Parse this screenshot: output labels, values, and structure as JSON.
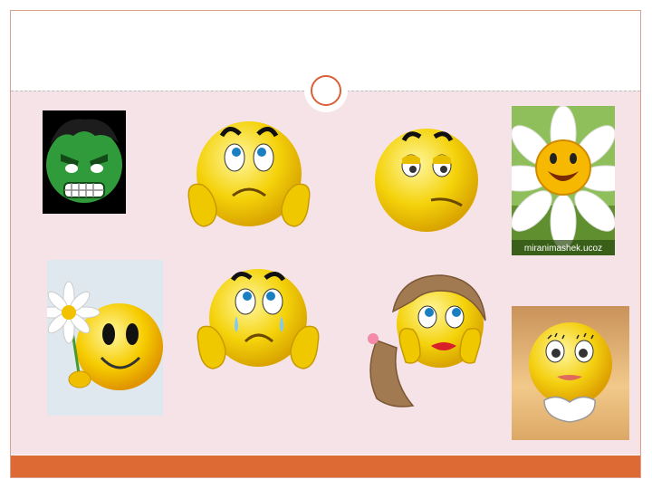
{
  "slide": {
    "accent_color": "#dd6a35",
    "content_background": "#f6e3e7",
    "frame_border_color": "#d9a08e"
  },
  "images": [
    {
      "name": "angry-green-face-icon"
    },
    {
      "name": "sad-face-hands-on-cheeks-icon"
    },
    {
      "name": "bored-smirk-face-icon"
    },
    {
      "name": "smiling-daisy-icon",
      "caption": "miranimashek.ucoz"
    },
    {
      "name": "smiley-holding-daisy-icon"
    },
    {
      "name": "crying-face-hands-on-cheeks-icon"
    },
    {
      "name": "dreamy-girl-face-with-ponytail-icon"
    },
    {
      "name": "shy-smiley-hands-clasped-icon"
    }
  ]
}
